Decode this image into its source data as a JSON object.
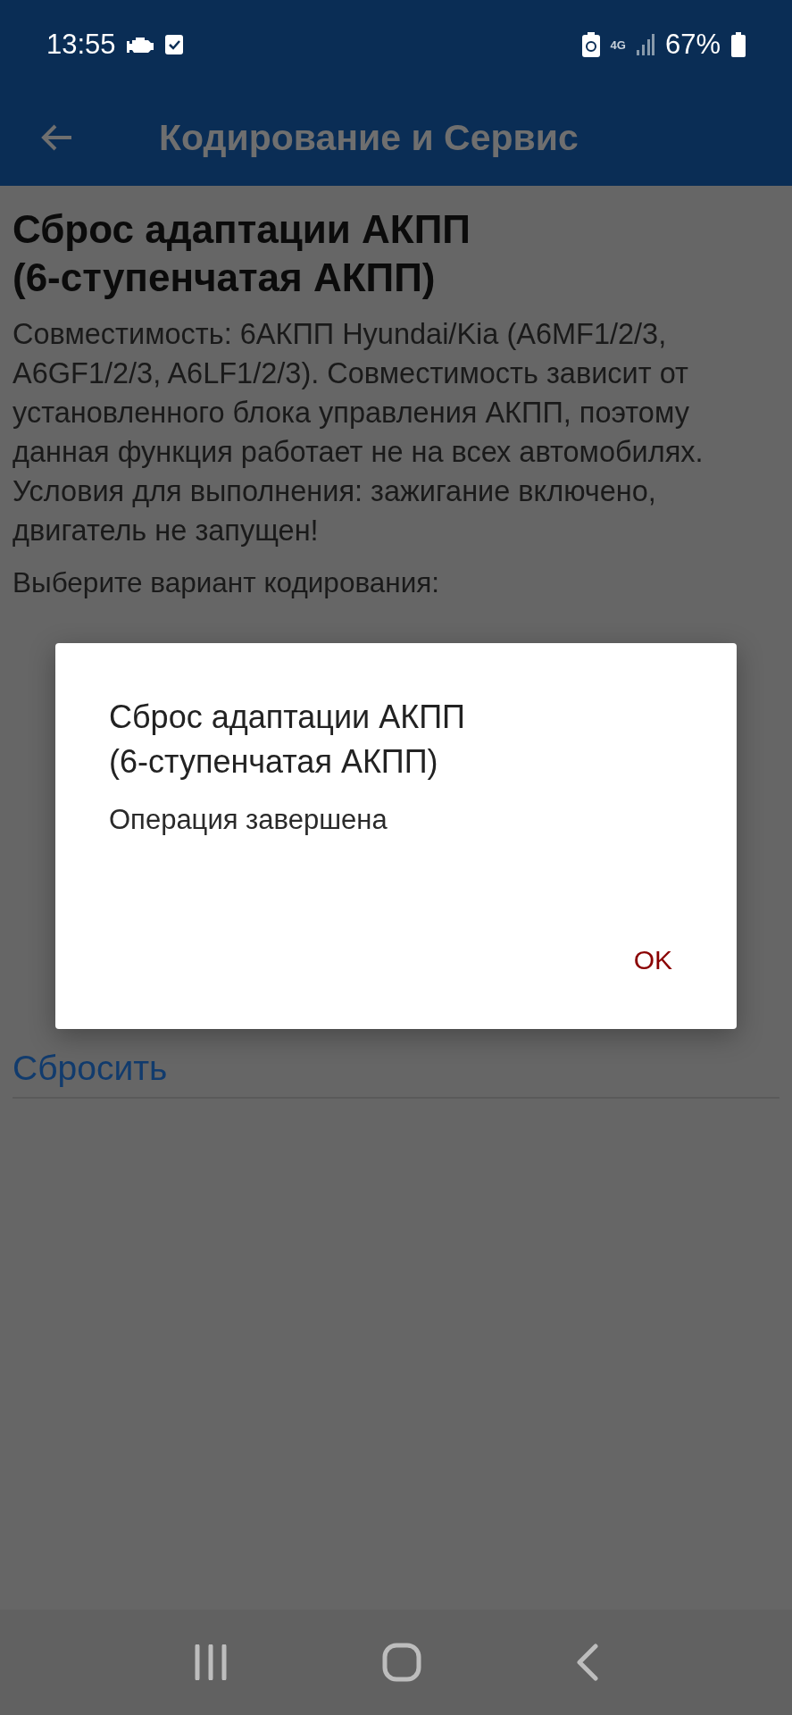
{
  "status_bar": {
    "time": "13:55",
    "network_type": "4G",
    "battery": "67%"
  },
  "app_bar": {
    "title": "Кодирование и Сервис"
  },
  "page": {
    "title": "Сброс адаптации АКПП (6-ступенчатая АКПП)",
    "description": "Совместимость: 6АКПП Hyundai/Kia (A6MF1/2/3, A6GF1/2/3, A6LF1/2/3). Совместимость зависит от установленного блока управления АКПП, поэтому данная функция работает не на всех автомобилях. Условия для выполнения: зажигание включено, двигатель не запущен!",
    "prompt": "Выберите вариант кодирования:",
    "action_link": "Сбросить"
  },
  "dialog": {
    "title": "Сброс адаптации АКПП (6-ступенчатая АКПП)",
    "message": "Операция завершена",
    "buttons": [
      "OK"
    ]
  }
}
